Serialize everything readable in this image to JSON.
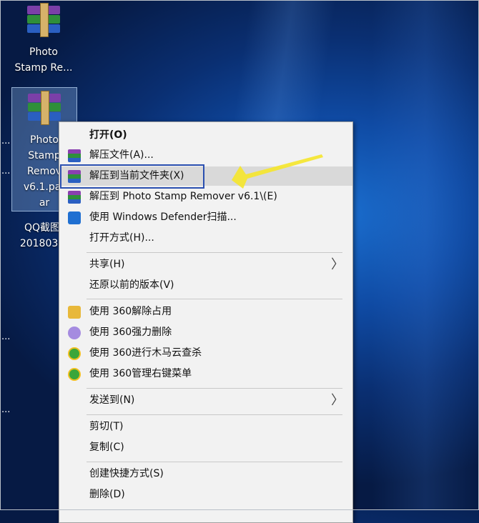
{
  "desktop": {
    "icons": [
      {
        "label_line1": "Photo",
        "label_line2": "Stamp Re..."
      },
      {
        "label_line1": "Photo",
        "label_line2": "Stamp",
        "label_line3": "Remov",
        "label_line4": "v6.1.par",
        "label_line5": "ar"
      },
      {
        "label_line1": "QQ截图",
        "label_line2": "2018030"
      }
    ],
    "side_dots": [
      "...",
      "...",
      "...",
      "..."
    ]
  },
  "context_menu": {
    "items": [
      {
        "label": "打开(O)",
        "bold": true,
        "icon": "none"
      },
      {
        "label": "解压文件(A)...",
        "icon": "winrar-icon"
      },
      {
        "label": "解压到当前文件夹(X)",
        "icon": "winrar-icon",
        "highlighted": true
      },
      {
        "label": "解压到 Photo Stamp Remover v6.1\\(E)",
        "icon": "winrar-icon"
      },
      {
        "label": "使用 Windows Defender扫描...",
        "icon": "defender-shield-icon"
      },
      {
        "label": "打开方式(H)...",
        "icon": "none"
      },
      {
        "label": "共享(H)",
        "icon": "none",
        "submenu": true
      },
      {
        "label": "还原以前的版本(V)",
        "icon": "none"
      },
      {
        "label": "使用 360解除占用",
        "icon": "360-unlock-folder-icon"
      },
      {
        "label": "使用 360强力删除",
        "icon": "360-delete-icon"
      },
      {
        "label": "使用 360进行木马云查杀",
        "icon": "360-scan-icon"
      },
      {
        "label": "使用 360管理右键菜单",
        "icon": "360-menu-icon"
      },
      {
        "label": "发送到(N)",
        "icon": "none",
        "submenu": true
      },
      {
        "label": "剪切(T)",
        "icon": "none"
      },
      {
        "label": "复制(C)",
        "icon": "none"
      },
      {
        "label": "创建快捷方式(S)",
        "icon": "none"
      },
      {
        "label": "删除(D)",
        "icon": "none"
      }
    ],
    "submenu_arrow": "〉"
  },
  "colors": {
    "highlight_box": "#2a4fb0",
    "annotation_arrow": "#f5e62a",
    "menu_bg": "#f2f2f2"
  }
}
